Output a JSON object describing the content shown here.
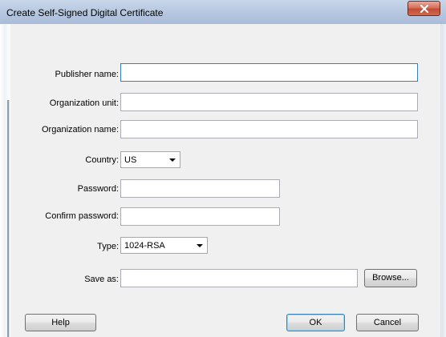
{
  "window": {
    "title": "Create Self-Signed Digital Certificate",
    "close_glyph": "x"
  },
  "form": {
    "publisher_name": {
      "label": "Publisher name:",
      "value": ""
    },
    "organization_unit": {
      "label": "Organization unit:",
      "value": ""
    },
    "organization_name": {
      "label": "Organization name:",
      "value": ""
    },
    "country": {
      "label": "Country:",
      "selected": "US"
    },
    "password": {
      "label": "Password:",
      "value": ""
    },
    "confirm_password": {
      "label": "Confirm password:",
      "value": ""
    },
    "type": {
      "label": "Type:",
      "selected": "1024-RSA"
    },
    "save_as": {
      "label": "Save as:",
      "value": "",
      "browse_label": "Browse..."
    }
  },
  "buttons": {
    "help": "Help",
    "ok": "OK",
    "cancel": "Cancel"
  },
  "colors": {
    "title_bar": "#b8c9e1",
    "close_button": "#c24a32",
    "dialog_background": "#f0f0f0",
    "focus_border": "#3c7fb1"
  }
}
